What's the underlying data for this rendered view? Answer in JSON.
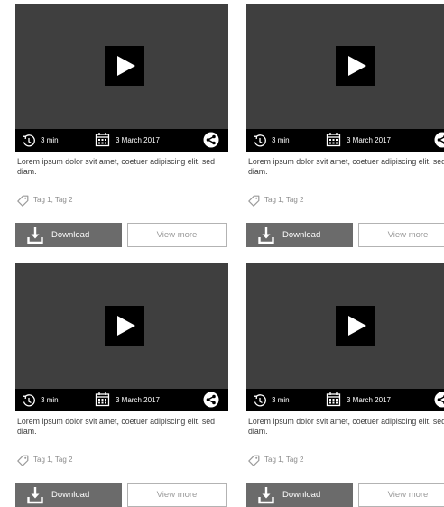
{
  "colors": {
    "video_bg": "#3f3f3f",
    "meta_bar": "#000000",
    "download_bg": "#6b6b6b",
    "text": "#3c3c3c",
    "muted": "#8a8a8a",
    "border": "#b3b3b3"
  },
  "icons": {
    "play": "play-icon",
    "duration": "clock-icon",
    "date": "calendar-icon",
    "share": "share-icon",
    "tag": "tag-icon",
    "download": "download-icon"
  },
  "cards": [
    {
      "duration": "3 min",
      "date": "3 March 2017",
      "description": "Lorem ipsum dolor svit amet, coetuer adipiscing elit, sed diam.",
      "tags": "Tag 1, Tag 2",
      "download_label": "Download",
      "view_more_label": "View more"
    },
    {
      "duration": "3 min",
      "date": "3 March 2017",
      "description": "Lorem ipsum dolor svit amet, coetuer adipiscing elit, sed diam.",
      "tags": "Tag 1, Tag 2",
      "download_label": "Download",
      "view_more_label": "View more"
    },
    {
      "duration": "3 min",
      "date": "3 March 2017",
      "description": "Lorem ipsum dolor svit amet, coetuer adipiscing elit, sed diam.",
      "tags": "Tag 1, Tag 2",
      "download_label": "Download",
      "view_more_label": "View more"
    },
    {
      "duration": "3 min",
      "date": "3 March 2017",
      "description": "Lorem ipsum dolor svit amet, coetuer adipiscing elit, sed diam.",
      "tags": "Tag 1, Tag 2",
      "download_label": "Download",
      "view_more_label": "View more"
    }
  ]
}
